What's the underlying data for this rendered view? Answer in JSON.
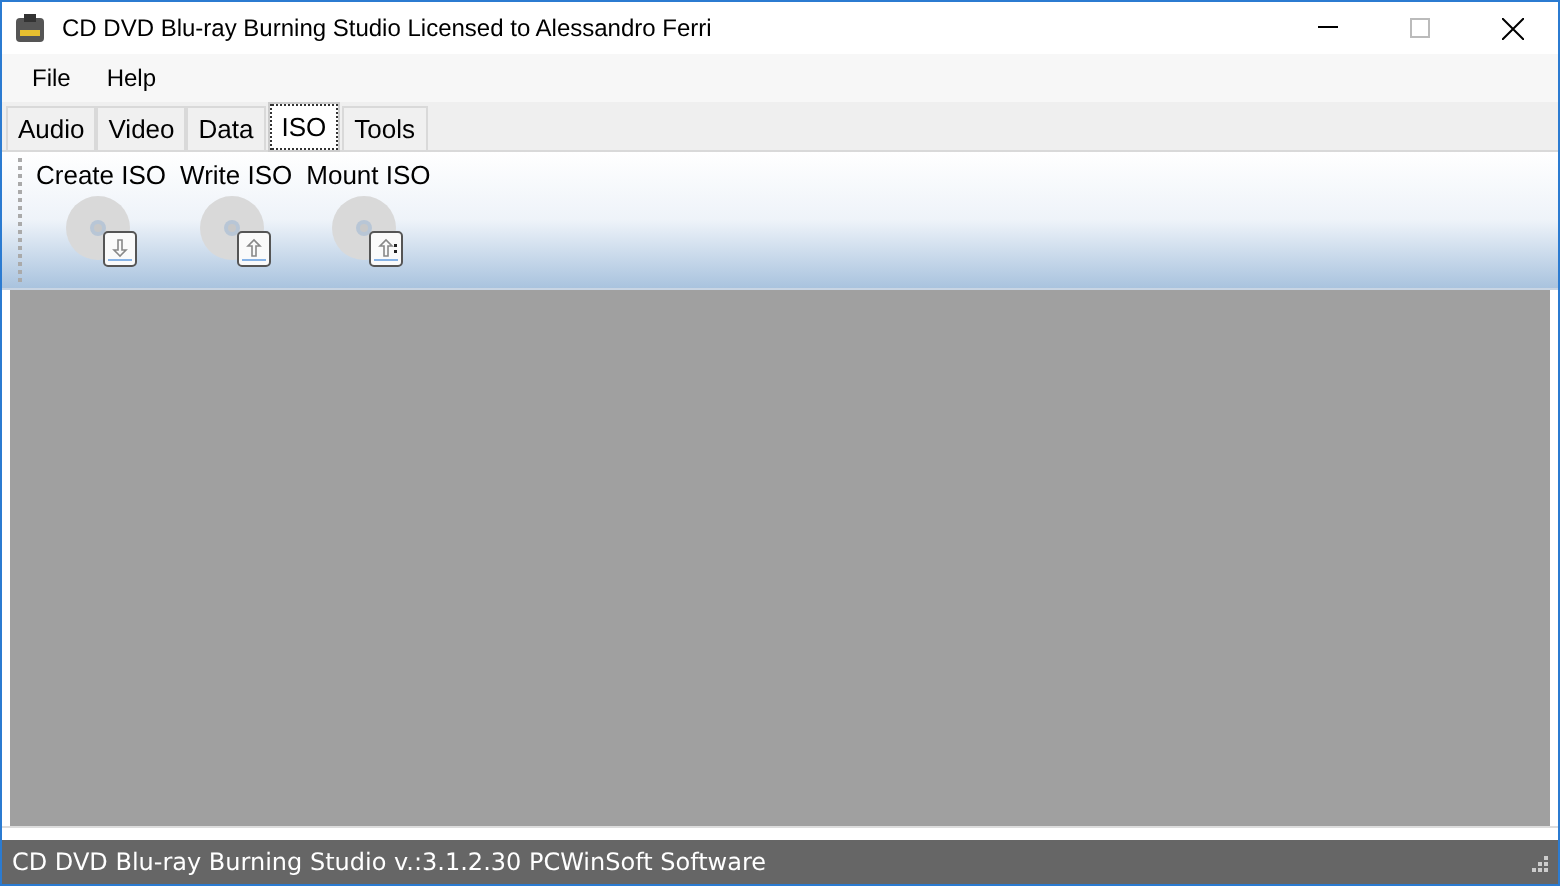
{
  "window": {
    "title": "CD DVD Blu-ray Burning Studio Licensed to Alessandro Ferri"
  },
  "menu": [
    "File",
    "Help"
  ],
  "tabs": [
    {
      "label": "Audio",
      "selected": false
    },
    {
      "label": "Video",
      "selected": false
    },
    {
      "label": "Data",
      "selected": false
    },
    {
      "label": "ISO",
      "selected": true
    },
    {
      "label": "Tools",
      "selected": false
    }
  ],
  "toolbar": [
    {
      "label": "Create ISO",
      "kind": "down"
    },
    {
      "label": "Write ISO",
      "kind": "up"
    },
    {
      "label": "Mount ISO",
      "kind": "mount"
    }
  ],
  "status_bar": "CD DVD Blu-ray Burning Studio v.:3.1.2.30 PCWinSoft Software"
}
